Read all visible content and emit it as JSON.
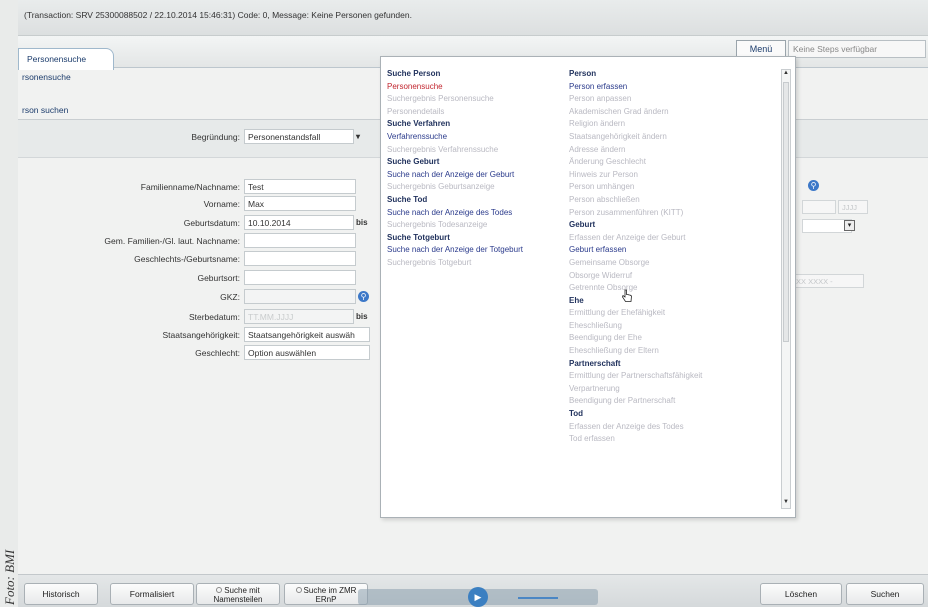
{
  "caption": "Foto: BMI",
  "header": {
    "transaction": "(Transaction: SRV 25300088502 / 22.10.2014 15:46:31)   Code: 0, Message: Keine Personen gefunden."
  },
  "tabs": [
    {
      "label": "Personensuche"
    }
  ],
  "toolbar": {
    "menu_label": "Menü",
    "steps_placeholder": "Keine Steps verfügbar"
  },
  "page": {
    "subtitle": "rsonensuche",
    "section": "rson suchen"
  },
  "form": {
    "begruendung": {
      "label": "Begründung:",
      "value": "Personenstandsfall"
    },
    "familienname": {
      "label": "Familienname/Nachname:",
      "value": "Test"
    },
    "vorname": {
      "label": "Vorname:",
      "value": "Max"
    },
    "geburtsdatum": {
      "label": "Geburtsdatum:",
      "value": "10.10.2014",
      "bis": "bis"
    },
    "gem_familien": {
      "label": "Gem. Familien-/Gl. laut. Nachname:",
      "value": ""
    },
    "geschlechtsname": {
      "label": "Geschlechts-/Geburtsname:",
      "value": ""
    },
    "geburtsort": {
      "label": "Geburtsort:",
      "value": ""
    },
    "gkz": {
      "label": "GKZ:",
      "value": ""
    },
    "sterbedatum": {
      "label": "Sterbedatum:",
      "value": "TT.MM.JJJJ",
      "bis": "bis"
    },
    "staatsangehoerigkeit": {
      "label": "Staatsangehörigkeit:",
      "value": "Staatsangehörigkeit auswäh"
    },
    "geschlecht": {
      "label": "Geschlecht:",
      "value": "Option auswählen"
    }
  },
  "right_fields": {
    "date_hint": "JJJJ",
    "code_hint": "XXXX XXXX - "
  },
  "menu": {
    "left": [
      {
        "label": "Suche Person",
        "kind": "head"
      },
      {
        "label": "Personensuche",
        "kind": "active"
      },
      {
        "label": "Suchergebnis Personensuche",
        "kind": "muted"
      },
      {
        "label": "Personendetails",
        "kind": "muted"
      },
      {
        "label": "Suche Verfahren",
        "kind": "head"
      },
      {
        "label": "Verfahrenssuche",
        "kind": "link"
      },
      {
        "label": "Suchergebnis Verfahrenssuche",
        "kind": "muted"
      },
      {
        "label": "Suche Geburt",
        "kind": "head"
      },
      {
        "label": "Suche nach der Anzeige der Geburt",
        "kind": "link"
      },
      {
        "label": "Suchergebnis Geburtsanzeige",
        "kind": "muted"
      },
      {
        "label": "Suche Tod",
        "kind": "head"
      },
      {
        "label": "Suche nach der Anzeige des Todes",
        "kind": "link"
      },
      {
        "label": "Suchergebnis Todesanzeige",
        "kind": "muted"
      },
      {
        "label": "Suche Totgeburt",
        "kind": "head"
      },
      {
        "label": "Suche nach der Anzeige der Totgeburt",
        "kind": "link"
      },
      {
        "label": "Suchergebnis Totgeburt",
        "kind": "muted"
      }
    ],
    "right": [
      {
        "label": "Person",
        "kind": "head"
      },
      {
        "label": "Person erfassen",
        "kind": "link"
      },
      {
        "label": "Person anpassen",
        "kind": "muted"
      },
      {
        "label": "Akademischen Grad ändern",
        "kind": "muted"
      },
      {
        "label": "Religion ändern",
        "kind": "muted"
      },
      {
        "label": "Staatsangehörigkeit ändern",
        "kind": "muted"
      },
      {
        "label": "Adresse ändern",
        "kind": "muted"
      },
      {
        "label": "Änderung Geschlecht",
        "kind": "muted"
      },
      {
        "label": "Hinweis zur Person",
        "kind": "muted"
      },
      {
        "label": "Person umhängen",
        "kind": "muted"
      },
      {
        "label": "Person abschließen",
        "kind": "muted"
      },
      {
        "label": "Person zusammenführen (KITT)",
        "kind": "muted"
      },
      {
        "label": "Geburt",
        "kind": "head"
      },
      {
        "label": "Erfassen der Anzeige der Geburt",
        "kind": "muted"
      },
      {
        "label": "Geburt erfassen",
        "kind": "link"
      },
      {
        "label": "Gemeinsame Obsorge",
        "kind": "muted"
      },
      {
        "label": "Obsorge Widerruf",
        "kind": "muted"
      },
      {
        "label": "Getrennte Obsorge",
        "kind": "muted"
      },
      {
        "label": "Ehe",
        "kind": "head"
      },
      {
        "label": "Ermittlung der Ehefähigkeit",
        "kind": "muted"
      },
      {
        "label": "Eheschließung",
        "kind": "muted"
      },
      {
        "label": "Beendigung der Ehe",
        "kind": "muted"
      },
      {
        "label": "Eheschließung der Eltern",
        "kind": "muted"
      },
      {
        "label": "Partnerschaft",
        "kind": "head"
      },
      {
        "label": "Ermittlung der Partnerschaftsfähigkeit",
        "kind": "muted"
      },
      {
        "label": "Verpartnerung",
        "kind": "muted"
      },
      {
        "label": "Beendigung der Partnerschaft",
        "kind": "muted"
      },
      {
        "label": "Tod",
        "kind": "head"
      },
      {
        "label": "Erfassen der Anzeige des Todes",
        "kind": "muted"
      },
      {
        "label": "Tod erfassen",
        "kind": "muted"
      }
    ]
  },
  "footer": {
    "historisch": "Historisch",
    "formalisiert": "Formalisiert",
    "suche_namen_1": "Suche mit",
    "suche_namen_2": "Namensteilen",
    "suche_zmr_1": "Suche im ZMR",
    "suche_zmr_2": "ERnP",
    "loeschen": "Löschen",
    "suchen": "Suchen"
  },
  "colors": {
    "active": "#c2262f",
    "link": "#2b3b8c",
    "head": "#22335e",
    "muted": "#b9b9c2",
    "accent": "#3c78c8"
  }
}
